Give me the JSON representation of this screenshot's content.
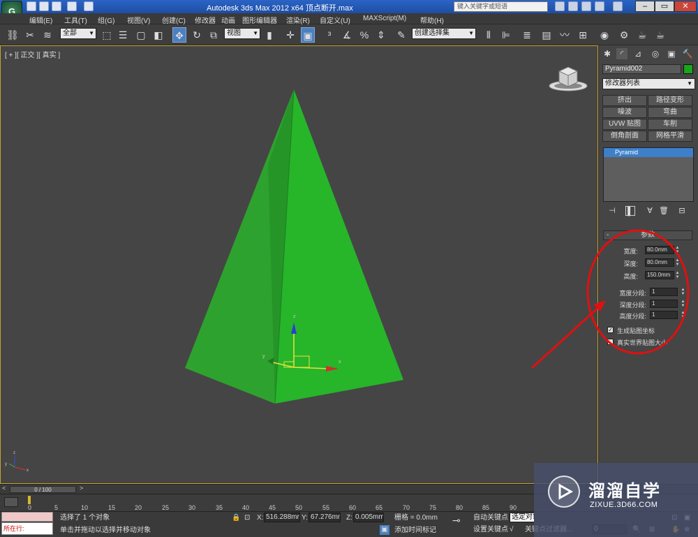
{
  "window": {
    "title": "Autodesk 3ds Max  2012 x64    顶点断开.max",
    "search_placeholder": "键入关键字或短语",
    "logo_label": "G"
  },
  "menu": [
    "编辑(E)",
    "工具(T)",
    "组(G)",
    "视图(V)",
    "创建(C)",
    "修改器",
    "动画",
    "图形编辑器",
    "渲染(R)",
    "自定义(U)",
    "MAXScript(M)",
    "帮助(H)"
  ],
  "toolbar": {
    "selection_filter": "全部",
    "ref_coord": "视图",
    "named_selection": "创建选择集"
  },
  "viewport": {
    "label": "[ + ][ 正交 ][ 真实 ]",
    "axis_labels": {
      "x": "x",
      "y": "y",
      "z": "z"
    }
  },
  "command_panel": {
    "object_name": "Pyramid002",
    "object_color": "#1aa51a",
    "modifier_list": "修改器列表",
    "modifier_buttons": [
      "挤出",
      "路径变形",
      "噪波",
      "弯曲",
      "UVW 贴图",
      "车削",
      "倒角剖面",
      "网格平滑"
    ],
    "stack_item": "Pyramid",
    "rollout_title": "参数",
    "params": [
      {
        "label": "宽度:",
        "value": "80.0mm"
      },
      {
        "label": "深度:",
        "value": "80.0mm"
      },
      {
        "label": "高度:",
        "value": "150.0mm"
      }
    ],
    "segments": [
      {
        "label": "宽度分段:",
        "value": "1"
      },
      {
        "label": "深度分段:",
        "value": "1"
      },
      {
        "label": "高度分段:",
        "value": "1"
      }
    ],
    "checkbox_gen_map": {
      "label": "生成贴图坐标",
      "checked": true
    },
    "checkbox_real_world": {
      "label": "真实世界贴图大小",
      "checked": false
    }
  },
  "timeline": {
    "frame_range": "0 / 100",
    "ticks": [
      "0",
      "5",
      "10",
      "15",
      "20",
      "25",
      "30",
      "35",
      "40",
      "45",
      "50",
      "55",
      "60",
      "65",
      "70",
      "75",
      "80",
      "85",
      "90"
    ]
  },
  "status": {
    "running_label": "所在行:",
    "selection_info": "选择了 1 个对象",
    "prompt": "单击并拖动以选择并移动对象",
    "x_label": "X:",
    "x_value": "516.288mm",
    "y_label": "Y:",
    "y_value": "67.276mm",
    "z_label": "Z:",
    "z_value": "0.005mm",
    "grid": "栅格 = 0.0mm",
    "add_time_tag": "添加时间标记",
    "auto_key": "自动关键点",
    "set_key": "设置关键点",
    "selected": "选定对象",
    "key_filters": "关键点过滤器...",
    "frame_value": "0"
  },
  "watermark": {
    "title": "溜溜自学",
    "subtitle": "ZIXUE.3D66.COM"
  }
}
